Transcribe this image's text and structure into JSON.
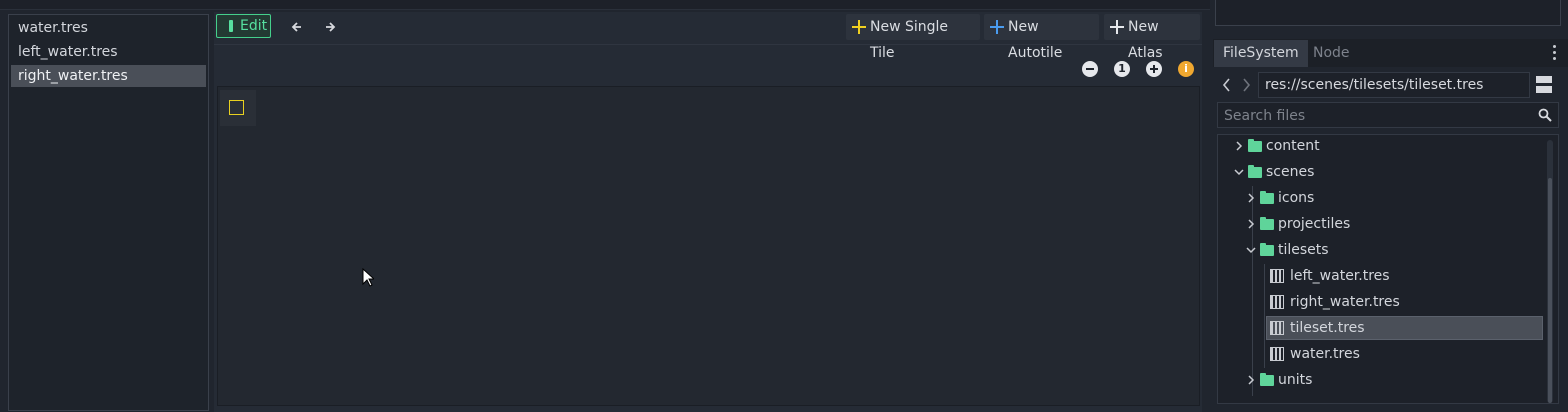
{
  "resources": {
    "items": [
      {
        "label": "water.tres",
        "selected": false
      },
      {
        "label": "left_water.tres",
        "selected": false
      },
      {
        "label": "right_water.tres",
        "selected": true
      }
    ]
  },
  "toolbar": {
    "edit_label": "Edit",
    "back_icon": "arrow-left-icon",
    "forward_icon": "arrow-right-icon",
    "new_single_tile": "New Single Tile",
    "new_autotile": "New Autotile",
    "new_atlas": "New Atlas",
    "colors": {
      "single_tile": "#f0d020",
      "autotile": "#4a9cf0",
      "atlas": "#e6e8ec",
      "edit": "#57e0a0"
    }
  },
  "zoom": {
    "zoom_out_icon": "minus-circle-icon",
    "reset_label": "1",
    "zoom_in_icon": "plus-circle-icon",
    "info_label": "i"
  },
  "dock": {
    "tabs": [
      {
        "label": "FileSystem",
        "active": true
      },
      {
        "label": "Node",
        "active": false
      }
    ],
    "path": "res://scenes/tilesets/tileset.tres",
    "search_placeholder": "Search files",
    "tree": [
      {
        "label": "content",
        "type": "folder",
        "expanded": false
      },
      {
        "label": "scenes",
        "type": "folder",
        "expanded": true
      },
      {
        "label": "icons",
        "type": "folder",
        "expanded": false
      },
      {
        "label": "projectiles",
        "type": "folder",
        "expanded": false
      },
      {
        "label": "tilesets",
        "type": "folder",
        "expanded": true
      },
      {
        "label": "left_water.tres",
        "type": "file"
      },
      {
        "label": "right_water.tres",
        "type": "file"
      },
      {
        "label": "tileset.tres",
        "type": "file",
        "selected": true
      },
      {
        "label": "water.tres",
        "type": "file"
      },
      {
        "label": "units",
        "type": "folder",
        "expanded": false
      }
    ],
    "folder_color": "#5fd49a"
  }
}
